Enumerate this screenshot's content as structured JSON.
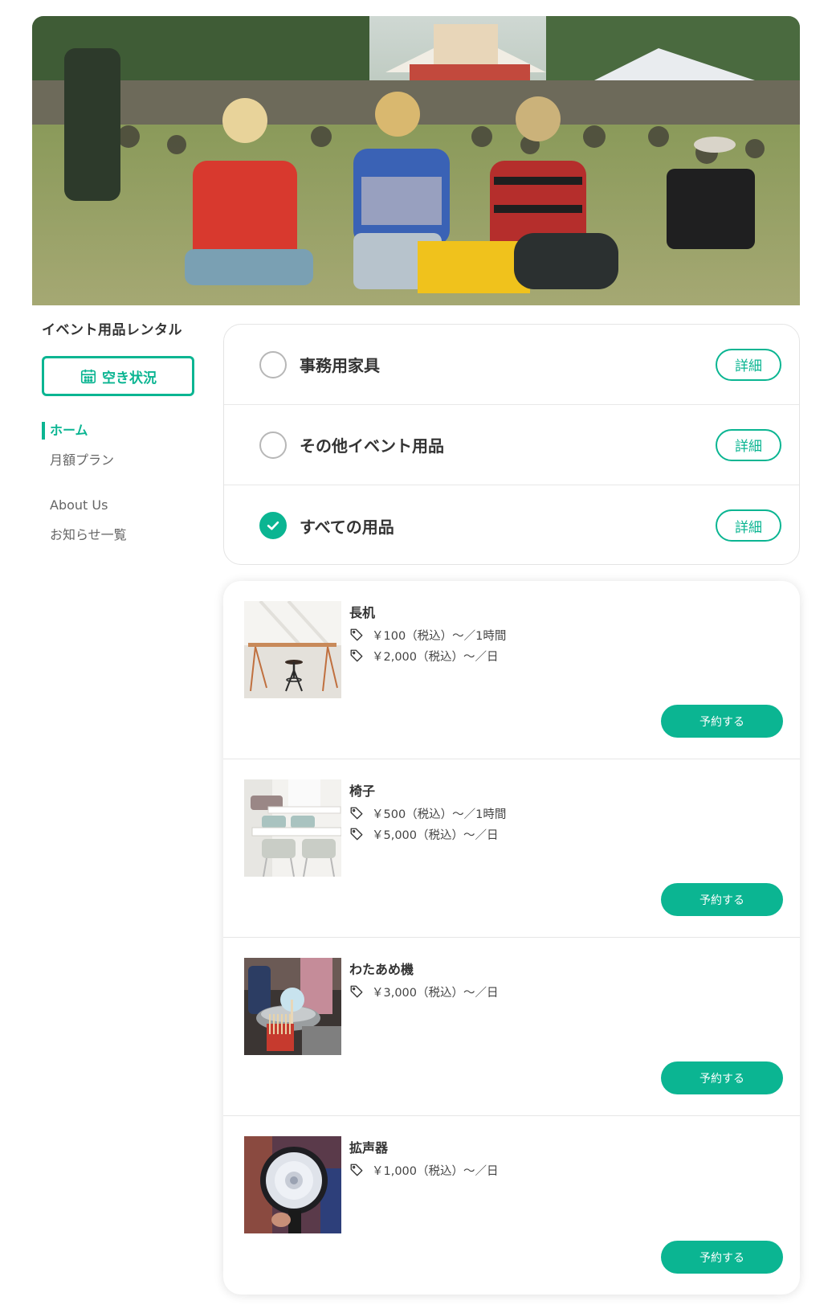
{
  "hero": {
    "image": "outdoor-festival-crowd-photo"
  },
  "sidebar": {
    "title": "イベント用品レンタル",
    "availability_button": "空き状況",
    "nav": [
      {
        "label": "ホーム",
        "active": true
      },
      {
        "label": "月額プラン",
        "active": false
      },
      {
        "label": "About Us",
        "active": false
      },
      {
        "label": "お知らせ一覧",
        "active": false
      }
    ]
  },
  "categories": [
    {
      "label": "事務用家具",
      "checked": false,
      "detail_label": "詳細"
    },
    {
      "label": "その他イベント用品",
      "checked": false,
      "detail_label": "詳細"
    },
    {
      "label": "すべての用品",
      "checked": true,
      "detail_label": "詳細"
    }
  ],
  "items": [
    {
      "name": "長机",
      "image": "long-table-photo",
      "prices": [
        "￥100（税込）〜／1時間",
        "￥2,000（税込）〜／日"
      ],
      "button": "予約する"
    },
    {
      "name": "椅子",
      "image": "chairs-photo",
      "prices": [
        "￥500（税込）〜／1時間",
        "￥5,000（税込）〜／日"
      ],
      "button": "予約する"
    },
    {
      "name": "わたあめ機",
      "image": "cotton-candy-machine-photo",
      "prices": [
        "￥3,000（税込）〜／日"
      ],
      "button": "予約する"
    },
    {
      "name": "拡声器",
      "image": "megaphone-photo",
      "prices": [
        "￥1,000（税込）〜／日"
      ],
      "button": "予約する"
    }
  ],
  "colors": {
    "accent": "#0bb592",
    "text": "#333333",
    "border": "#e4e4e4"
  },
  "icons": {
    "calendar": "calendar-icon",
    "check": "check-icon",
    "tag": "price-tag-icon"
  }
}
